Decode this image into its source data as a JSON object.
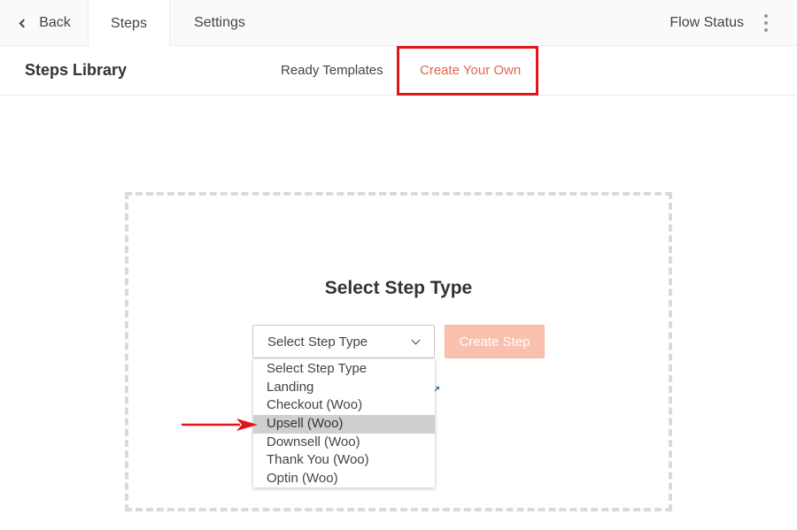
{
  "topbar": {
    "back_label": "Back",
    "tabs": [
      {
        "label": "Steps",
        "active": true
      },
      {
        "label": "Settings",
        "active": false
      }
    ],
    "flow_status_label": "Flow Status",
    "more_icon": "kebab-vertical-icon"
  },
  "library": {
    "title": "Steps Library",
    "tabs": [
      {
        "label": "Ready Templates",
        "active": false
      },
      {
        "label": "Create Your Own",
        "active": true
      }
    ],
    "accent_color": "#e0664f",
    "annotation_box_color": "#e3141b"
  },
  "create_panel": {
    "heading": "Select Step Type",
    "select": {
      "value": "Select Step Type",
      "options": [
        "Select Step Type",
        "Landing",
        "Checkout (Woo)",
        "Upsell (Woo)",
        "Downsell (Woo)",
        "Thank You (Woo)",
        "Optin (Woo)"
      ],
      "highlighted_option": "Upsell (Woo)"
    },
    "create_button_label": "Create Step",
    "create_button_color": "#f9c0ae",
    "external_link_icon": "external-link-icon"
  },
  "annotation": {
    "arrow_color": "#e3141b",
    "points_to": "Upsell (Woo)"
  }
}
